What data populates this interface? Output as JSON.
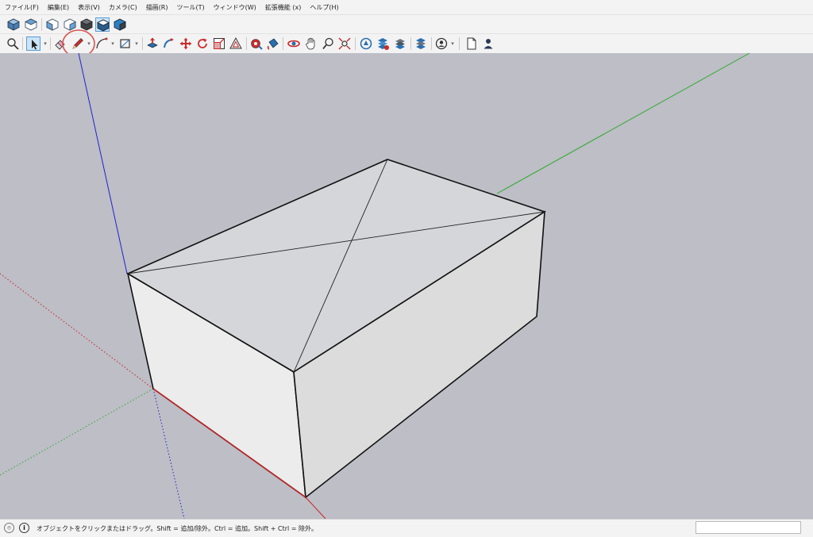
{
  "menubar": {
    "items": [
      "ファイル(F)",
      "編集(E)",
      "表示(V)",
      "カメラ(C)",
      "描画(R)",
      "ツール(T)",
      "ウィンドウ(W)",
      "拡張機能 (x)",
      "ヘルプ(H)"
    ]
  },
  "toolbar_views": {
    "icons": [
      "iso-view-icon",
      "top-view-icon",
      "front-view-icon",
      "right-view-icon",
      "back-view-icon",
      "left-view-icon",
      "bottom-view-icon"
    ]
  },
  "toolbar_tools": {
    "icons": [
      "zoom-icon",
      "select-icon",
      "eraser-icon",
      "pencil-icon",
      "arc-icon",
      "rectangle-icon",
      "push-pull-icon",
      "follow-me-icon",
      "move-icon",
      "rotate-icon",
      "scale-icon",
      "offset-icon",
      "tape-measure-icon",
      "paint-icon",
      "orbit-icon",
      "pan-icon",
      "zoom-window-icon",
      "zoom-extents-icon",
      "warehouse-icon",
      "extension-warehouse-icon",
      "layers-icon",
      "send-layout-icon",
      "account-icon",
      "new-file-icon",
      "user-icon"
    ],
    "active_tool": "select-icon",
    "highlighted_tool": "pencil-icon",
    "highlight_color": "#d9534f"
  },
  "status": {
    "message": "オブジェクトをクリックまたはドラッグ。Shift = 追加/除外。Ctrl = 追加。Shift + Ctrl = 除外。",
    "icons": [
      "geo-location-icon",
      "info-icon"
    ],
    "measurements_value": ""
  },
  "colors": {
    "background": "#bdbec6",
    "toolbar": "#f3f3f3",
    "axis_red": "#cc2222",
    "axis_green": "#33aa33",
    "axis_blue": "#2222cc",
    "top_face": "#d5d6da",
    "front_face": "#ececec",
    "right_face": "#dcdcdc"
  }
}
